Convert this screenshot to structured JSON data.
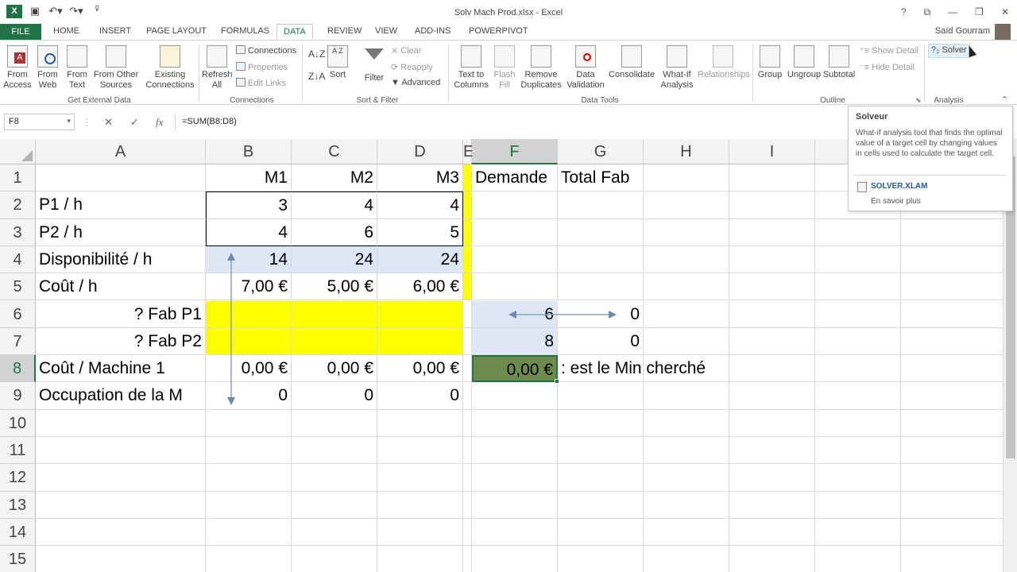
{
  "window": {
    "title": "Solv Mach Prod.xlsx - Excel",
    "user": "Saïd Gourram"
  },
  "qat": {
    "save_icon": "save-icon",
    "undo_icon": "undo-icon",
    "redo_icon": "redo-icon"
  },
  "tabs": [
    "FILE",
    "HOME",
    "INSERT",
    "PAGE LAYOUT",
    "FORMULAS",
    "DATA",
    "REVIEW",
    "VIEW",
    "ADD-INS",
    "POWERPIVOT"
  ],
  "active_tab": "DATA",
  "ribbon": {
    "get_external_data": {
      "label": "Get External Data",
      "from_access": "From Access",
      "from_web": "From Web",
      "from_text": "From Text",
      "from_other": "From Other Sources",
      "existing": "Existing Connections"
    },
    "connections": {
      "label": "Connections",
      "refresh": "Refresh All",
      "connections": "Connections",
      "properties": "Properties",
      "edit_links": "Edit Links"
    },
    "sort_filter": {
      "label": "Sort & Filter",
      "sort": "Sort",
      "filter": "Filter",
      "clear": "Clear",
      "reapply": "Reapply",
      "advanced": "Advanced"
    },
    "data_tools": {
      "label": "Data Tools",
      "text_to_columns": "Text to Columns",
      "flash_fill": "Flash Fill",
      "remove_duplicates": "Remove Duplicates",
      "data_validation": "Data Validation",
      "consolidate": "Consolidate",
      "what_if": "What-If Analysis",
      "relationships": "Relationships"
    },
    "outline": {
      "label": "Outline",
      "group": "Group",
      "ungroup": "Ungroup",
      "subtotal": "Subtotal",
      "show_detail": "Show Detail",
      "hide_detail": "Hide Detail"
    },
    "analysis": {
      "label": "Analysis",
      "solver": "Solver"
    }
  },
  "formula_bar": {
    "name_box": "F8",
    "formula": "=SUM(B8:D8)"
  },
  "tooltip": {
    "title": "Solveur",
    "body": "What-if analysis tool that finds the optimal value of a target cell by changing values in cells used to calculate the target cell.",
    "addin": "SOLVER.XLAM",
    "link": "En savoir plus"
  },
  "columns": [
    "A",
    "B",
    "C",
    "D",
    "E",
    "F",
    "G",
    "H",
    "I"
  ],
  "rows": [
    "1",
    "2",
    "3",
    "4",
    "5",
    "6",
    "7",
    "8",
    "9",
    "10",
    "11",
    "12",
    "13",
    "14",
    "15"
  ],
  "cells": {
    "B1": "M1",
    "C1": "M2",
    "D1": "M3",
    "F1": "Demande",
    "G1": "Total Fab",
    "A2": "P1 / h",
    "B2": "3",
    "C2": "4",
    "D2": "4",
    "A3": "P2 / h",
    "B3": "4",
    "C3": "6",
    "D3": "5",
    "A4": "Disponibilité / h",
    "B4": "14",
    "C4": "24",
    "D4": "24",
    "A5": "Coût / h",
    "B5": "7,00 €",
    "C5": "5,00 €",
    "D5": "6,00 €",
    "A6": "? Fab P1",
    "F6": "6",
    "G6": "0",
    "A7": "? Fab P2",
    "F7": "8",
    "G7": "0",
    "A8": "Coût / Machine 1",
    "B8": "0,00 €",
    "C8": "0,00 €",
    "D8": "0,00 €",
    "F8": "0,00 €",
    "G8": ": est le Min cherché",
    "A9": "Occupation de la M",
    "B9": "0",
    "C9": "0",
    "D9": "0"
  },
  "colors": {
    "excel_green": "#217346",
    "yellow": "#FFFF00",
    "light_blue": "#DDE7F6",
    "selected_fill": "#6E8B4E"
  }
}
